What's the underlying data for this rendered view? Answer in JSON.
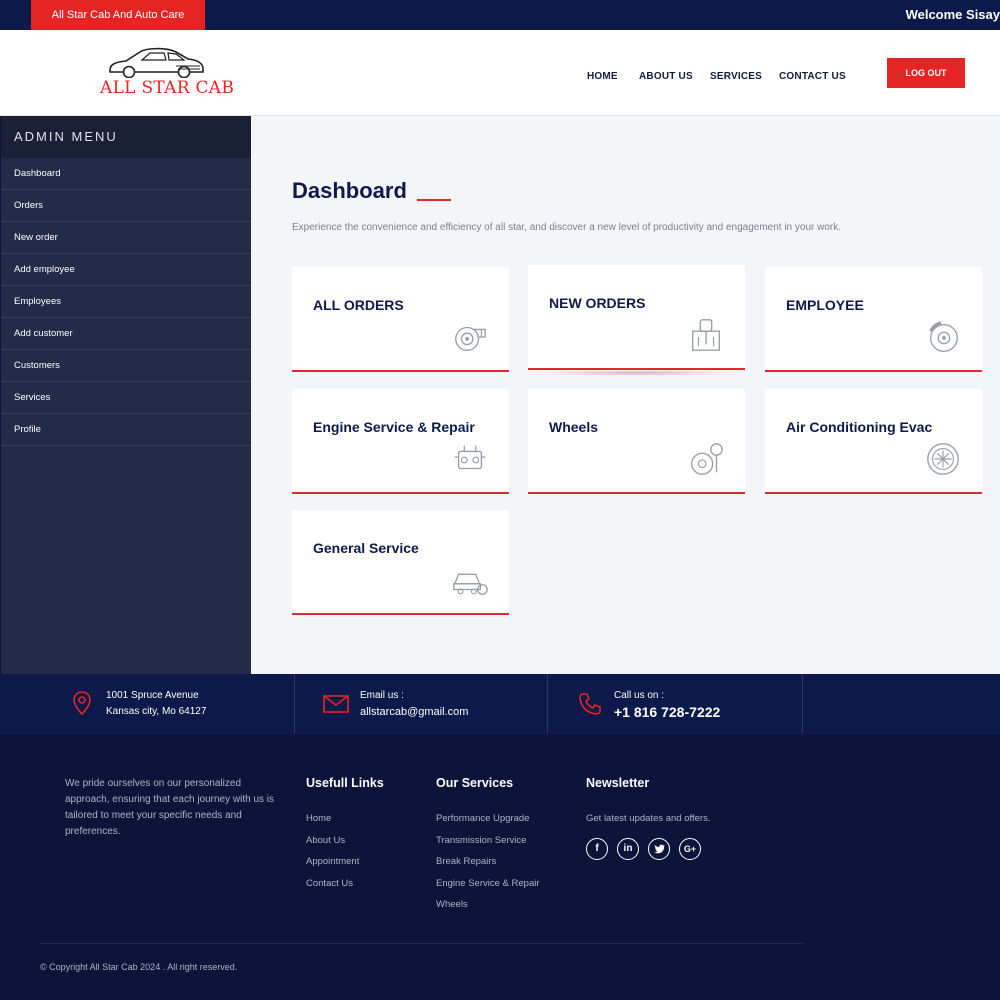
{
  "topbar": {
    "brand_tag": "All Star Cab And Auto Care",
    "welcome": "Welcome Sisay"
  },
  "header": {
    "logo_text": "ALL STAR CAB",
    "nav": [
      "HOME",
      "ABOUT US",
      "SERVICES",
      "CONTACT US"
    ],
    "logout_label": "LOG OUT"
  },
  "sidebar": {
    "title": "ADMIN MENU",
    "items": [
      "Dashboard",
      "Orders",
      "New order",
      "Add employee",
      "Employees",
      "Add customer",
      "Customers",
      "Services",
      "Profile"
    ]
  },
  "main": {
    "title": "Dashboard",
    "description": "Experience the convenience and efficiency of all star, and discover a new level of productivity and engagement in your work.",
    "cards": [
      {
        "title": "ALL ORDERS",
        "icon": "turbo-icon"
      },
      {
        "title": "NEW ORDERS",
        "icon": "gear-shift-icon"
      },
      {
        "title": "EMPLOYEE",
        "icon": "brake-disc-icon"
      },
      {
        "title": "Engine Service & Repair",
        "icon": "engine-icon"
      },
      {
        "title": "Wheels",
        "icon": "tire-pressure-icon"
      },
      {
        "title": "Air Conditioning Evac",
        "icon": "ac-fan-icon"
      },
      {
        "title": "General Service",
        "icon": "car-service-icon"
      }
    ]
  },
  "contact": {
    "address_line1": "1001 Spruce Avenue",
    "address_line2": "Kansas city, Mo 64127",
    "email_label": "Email us :",
    "email": "allstarcab@gmail.com",
    "phone_label": "Call us on :",
    "phone": "+1 816 728-7222"
  },
  "footer": {
    "about": "We pride ourselves on our personalized approach, ensuring that each journey with us is tailored to meet your specific needs and preferences.",
    "links_title": "Usefull Links",
    "links": [
      "Home",
      "About Us",
      "Appointment",
      "Contact Us"
    ],
    "services_title": "Our Services",
    "services": [
      "Performance Upgrade",
      "Transmission Service",
      "Break Repairs",
      "Engine Service & Repair",
      "Wheels"
    ],
    "newsletter_title": "Newsletter",
    "newsletter_text": "Get latest updates and offers.",
    "social": [
      "f",
      "in",
      "t",
      "G+"
    ],
    "copyright": "© Copyright All Star Cab 2024 . All right reserved."
  },
  "colors": {
    "accent_red": "#e52424",
    "navy": "#0b1a4a",
    "sidebar": "#222b48",
    "title_navy": "#0e1a4b"
  }
}
